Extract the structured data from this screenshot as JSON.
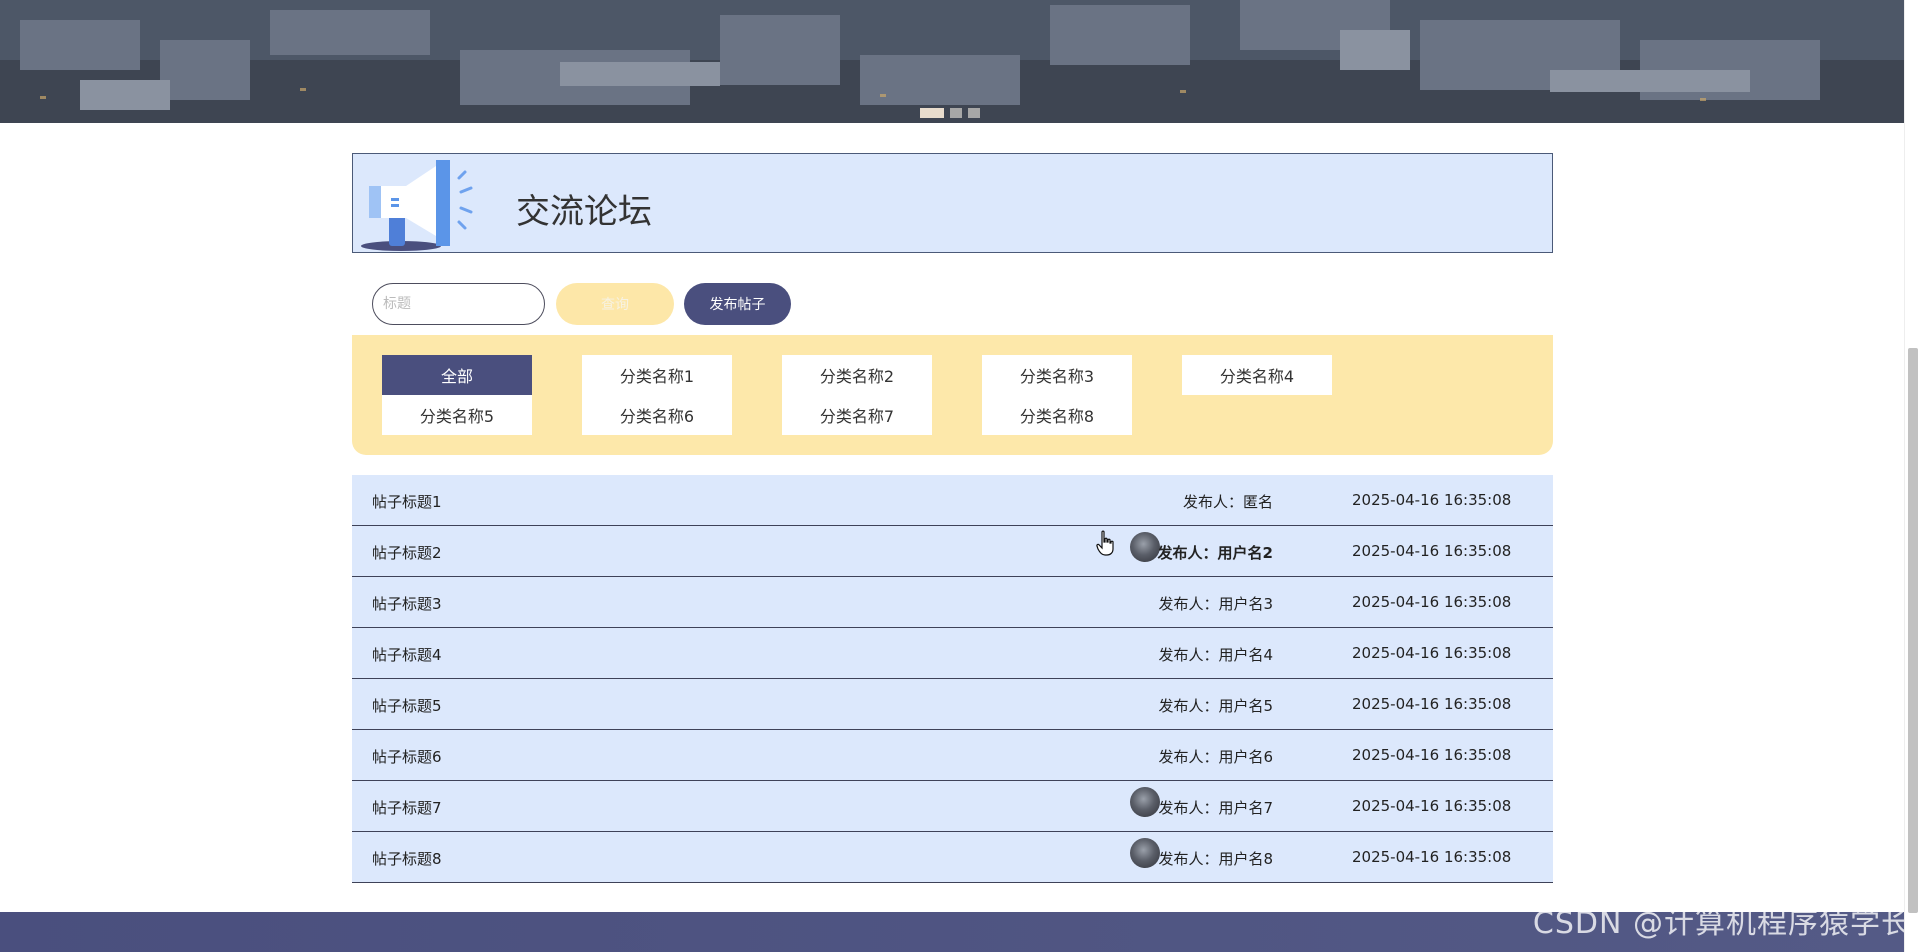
{
  "banner": {
    "slide_count": 3,
    "active_slide": 1
  },
  "header": {
    "title": "交流论坛"
  },
  "search": {
    "placeholder": "标题",
    "value": "",
    "search_label": "查询",
    "publish_label": "发布帖子"
  },
  "categories": [
    "全部",
    "分类名称1",
    "分类名称2",
    "分类名称3",
    "分类名称4",
    "分类名称5",
    "分类名称6",
    "分类名称7",
    "分类名称8"
  ],
  "active_category": "全部",
  "posts": [
    {
      "title": "帖子标题1",
      "author": "发布人：匿名",
      "time": "2025-04-16 16:35:08",
      "avatar": false,
      "bold": false
    },
    {
      "title": "帖子标题2",
      "author": "发布人：用户名2",
      "time": "2025-04-16 16:35:08",
      "avatar": true,
      "bold": true
    },
    {
      "title": "帖子标题3",
      "author": "发布人：用户名3",
      "time": "2025-04-16 16:35:08",
      "avatar": false,
      "bold": false
    },
    {
      "title": "帖子标题4",
      "author": "发布人：用户名4",
      "time": "2025-04-16 16:35:08",
      "avatar": false,
      "bold": false
    },
    {
      "title": "帖子标题5",
      "author": "发布人：用户名5",
      "time": "2025-04-16 16:35:08",
      "avatar": false,
      "bold": false
    },
    {
      "title": "帖子标题6",
      "author": "发布人：用户名6",
      "time": "2025-04-16 16:35:08",
      "avatar": false,
      "bold": false
    },
    {
      "title": "帖子标题7",
      "author": "发布人：用户名7",
      "time": "2025-04-16 16:35:08",
      "avatar": true,
      "bold": false
    },
    {
      "title": "帖子标题8",
      "author": "发布人：用户名8",
      "time": "2025-04-16 16:35:08",
      "avatar": true,
      "bold": false
    }
  ],
  "watermark": "CSDN @计算机程序猿学长",
  "colors": {
    "accent": "#4a4f7e",
    "search_button": "#fde7a8",
    "header_bg": "#dce8fc",
    "category_panel_bg": "#fde8aa"
  },
  "icons": {
    "header_icon": "megaphone-icon",
    "cursor": "hand-pointer-icon"
  }
}
